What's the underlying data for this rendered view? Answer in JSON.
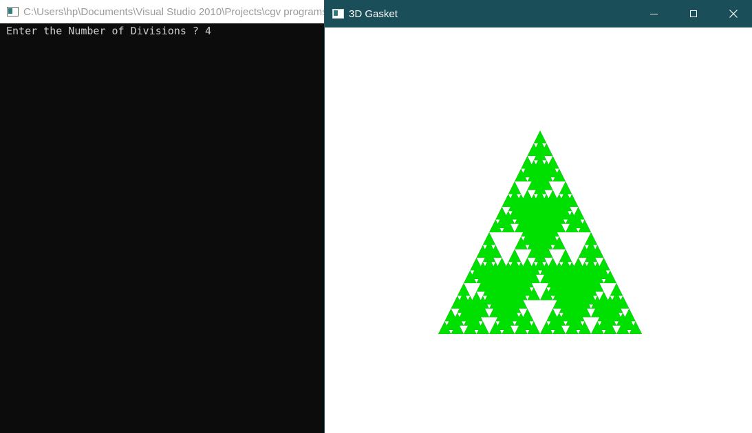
{
  "console": {
    "title": "C:\\Users\\hp\\Documents\\Visual Studio 2010\\Projects\\cgv programs",
    "output_line": "Enter the Number of Divisions ? 4"
  },
  "gl_window": {
    "title": "3D Gasket"
  },
  "gasket": {
    "divisions": 4,
    "face_colors": {
      "left": "#e00000",
      "right": "#0000ee",
      "bottom": "#00e000",
      "back": "#000000"
    }
  }
}
